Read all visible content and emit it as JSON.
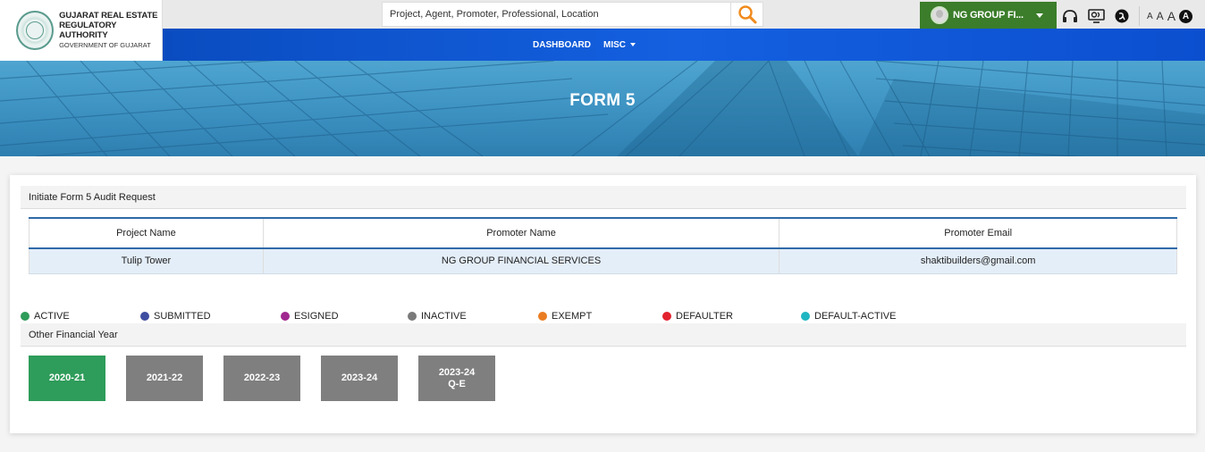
{
  "header": {
    "logo": {
      "line1": "GUJARAT REAL ESTATE",
      "line2": "REGULATORY AUTHORITY",
      "line3": "GOVERNMENT OF GUJARAT"
    },
    "search": {
      "placeholder": "Project, Agent, Promoter, Professional, Location"
    },
    "user": {
      "name": "NG GROUP FI..."
    },
    "font_sizes": [
      "A",
      "A",
      "A"
    ],
    "contrast_label": "A",
    "nav": [
      {
        "label": "DASHBOARD"
      },
      {
        "label": "MISC"
      }
    ]
  },
  "banner": {
    "title": "FORM 5"
  },
  "audit": {
    "title": "Initiate Form 5 Audit Request",
    "columns": [
      "Project Name",
      "Promoter Name",
      "Promoter Email"
    ],
    "rows": [
      [
        "Tulip Tower",
        "NG GROUP FINANCIAL SERVICES",
        "shaktibuilders@gmail.com"
      ]
    ]
  },
  "legend": [
    {
      "label": "ACTIVE",
      "color": "#2e9c5a"
    },
    {
      "label": "SUBMITTED",
      "color": "#3f4ea0"
    },
    {
      "label": "ESIGNED",
      "color": "#a0278f"
    },
    {
      "label": "INACTIVE",
      "color": "#7a7a7a"
    },
    {
      "label": "EXEMPT",
      "color": "#ea7d22"
    },
    {
      "label": "DEFAULTER",
      "color": "#e2222e"
    },
    {
      "label": "DEFAULT-ACTIVE",
      "color": "#1fb6c1"
    }
  ],
  "financial_years": {
    "title": "Other Financial Year",
    "items": [
      {
        "line1": "2020-21",
        "line2": "",
        "color": "#2e9c5a"
      },
      {
        "line1": "2021-22",
        "line2": "",
        "color": "#7f7f7f"
      },
      {
        "line1": "2022-23",
        "line2": "",
        "color": "#7f7f7f"
      },
      {
        "line1": "2023-24",
        "line2": "",
        "color": "#7f7f7f"
      },
      {
        "line1": "2023-24",
        "line2": "Q-E",
        "color": "#7f7f7f"
      }
    ]
  }
}
